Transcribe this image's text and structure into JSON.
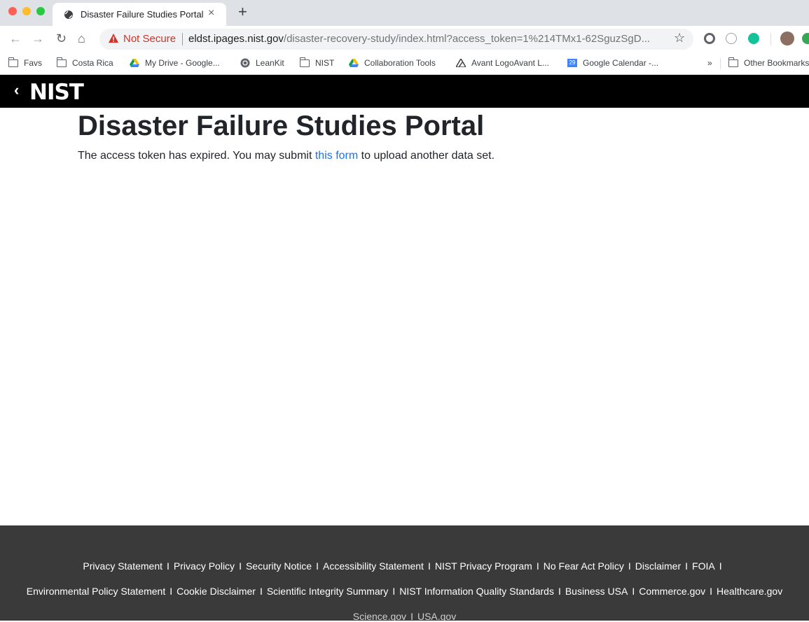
{
  "browser": {
    "tab_title": "Disaster Failure Studies Portal",
    "new_tab_label": "+",
    "security_label": "Not Secure",
    "url_host": "eldst.ipages.nist.gov",
    "url_path": "/disaster-recovery-study/index.html?access_token=1%214TMx1-62SguzSgD...",
    "bookmarks": [
      {
        "label": "Favs",
        "icon": "folder-icon"
      },
      {
        "label": "Costa Rica",
        "icon": "folder-icon"
      },
      {
        "label": "My Drive - Google...",
        "icon": "google-drive-icon"
      },
      {
        "label": "LeanKit",
        "icon": "leankit-icon"
      },
      {
        "label": "NIST",
        "icon": "folder-icon"
      },
      {
        "label": "Collaboration Tools",
        "icon": "google-drive-icon"
      },
      {
        "label": "Avant LogoAvant L...",
        "icon": "avant-logo-icon"
      },
      {
        "label": "Google Calendar -...",
        "icon": "google-calendar-icon"
      }
    ],
    "more_bookmarks": "»",
    "other_bookmarks": "Other Bookmarks",
    "calendar_day": "29"
  },
  "header": {
    "back_symbol": "‹",
    "logo_text": "NIST"
  },
  "main": {
    "title": "Disaster Failure Studies Portal",
    "message_before": "The access token has expired. You may submit ",
    "link_text": "this form",
    "message_after": " to upload another data set."
  },
  "footer": {
    "separator": "I",
    "row1": [
      "Privacy Statement",
      "Privacy Policy",
      "Security Notice",
      "Accessibility Statement",
      "NIST Privacy Program",
      "No Fear Act Policy",
      "Disclaimer",
      "FOIA"
    ],
    "row2": [
      "Environmental Policy Statement",
      "Cookie Disclaimer",
      "Scientific Integrity Summary",
      "NIST Information Quality Standards",
      "Business USA",
      "Commerce.gov",
      "Healthcare.gov"
    ],
    "row3": [
      "Science.gov",
      "USA.gov"
    ]
  },
  "colors": {
    "link": "#1a73e8",
    "nist_bar": "#000000",
    "footer_bg": "#3a3a3a",
    "not_secure": "#d93025"
  }
}
